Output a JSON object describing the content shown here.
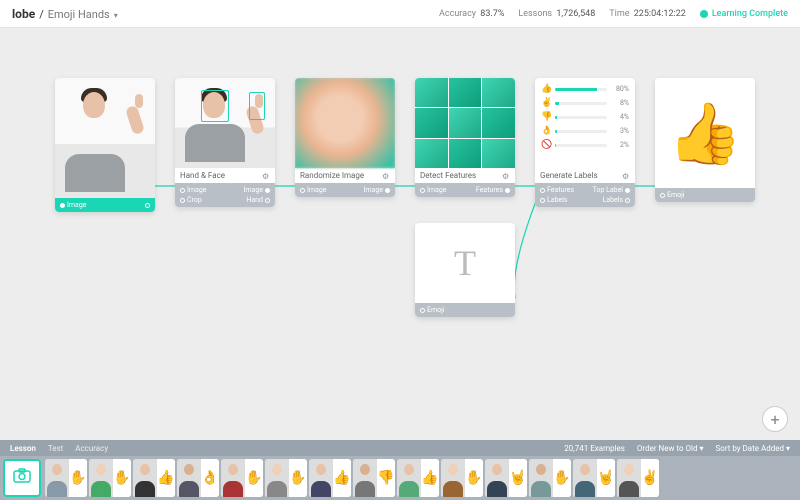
{
  "header": {
    "brand": "lobe",
    "divider": "/",
    "project": "Emoji Hands",
    "stats": {
      "accuracy_label": "Accuracy",
      "accuracy_value": "83.7%",
      "lessons_label": "Lessons",
      "lessons_value": "1,726,548",
      "time_label": "Time",
      "time_value": "225:04:12:22"
    },
    "status_text": "Learning Complete"
  },
  "icons": {
    "chevron_down": "▾",
    "gear": "⚙",
    "camera": "📷",
    "plus": "+"
  },
  "nodes": {
    "input": {
      "port_in": "Image",
      "title": ""
    },
    "handface": {
      "title": "Hand & Face",
      "port_in": "Image",
      "port_out": "Image",
      "port_row2_left": "Crop",
      "port_row2_right": "Hand"
    },
    "randomize": {
      "title": "Randomize Image",
      "port_in": "Image",
      "port_out": "Image"
    },
    "detect": {
      "title": "Detect Features",
      "port_in": "Image",
      "port_out": "Features"
    },
    "labels": {
      "title": "Generate Labels",
      "port_in": "Features",
      "port_out": "Top Label",
      "port_row2_left": "Labels",
      "port_row2_right": "Labels",
      "items": [
        {
          "glyph": "👍",
          "pct": 80
        },
        {
          "glyph": "✌️",
          "pct": 8
        },
        {
          "glyph": "👎",
          "pct": 4
        },
        {
          "glyph": "👌",
          "pct": 3
        },
        {
          "glyph": "🚫",
          "pct": 2
        }
      ],
      "pct_suffix": "%"
    },
    "output": {
      "title": "",
      "port_in": "Emoji",
      "glyph": "👍"
    },
    "text": {
      "glyph_T": "T",
      "port_in": "Emoji"
    }
  },
  "footer": {
    "tabs": [
      "Lesson",
      "Test",
      "Accuracy"
    ],
    "active_tab": "Lesson",
    "examples_count": "20,741 Examples",
    "order_label": "Order New to Old",
    "sort_label": "Sort by Date Added",
    "thumbs": [
      {
        "emoji": "✋",
        "skin": "#e8c2a8",
        "shirt": "#8899aa"
      },
      {
        "emoji": "✋",
        "skin": "#f0d0b8",
        "shirt": "#4a6"
      },
      {
        "emoji": "👍",
        "skin": "#e8c2a8",
        "shirt": "#333"
      },
      {
        "emoji": "👌",
        "skin": "#d9b090",
        "shirt": "#556"
      },
      {
        "emoji": "✋",
        "skin": "#e8c2a8",
        "shirt": "#a33"
      },
      {
        "emoji": "✋",
        "skin": "#f0d0b8",
        "shirt": "#888"
      },
      {
        "emoji": "👍",
        "skin": "#e8c2a8",
        "shirt": "#446"
      },
      {
        "emoji": "👎",
        "skin": "#d9b090",
        "shirt": "#777"
      },
      {
        "emoji": "👍",
        "skin": "#e8c2a8",
        "shirt": "#5a7"
      },
      {
        "emoji": "✋",
        "skin": "#f0d0b8",
        "shirt": "#963"
      },
      {
        "emoji": "🤘",
        "skin": "#e8c2a8",
        "shirt": "#345"
      },
      {
        "emoji": "✋",
        "skin": "#d9b090",
        "shirt": "#799"
      },
      {
        "emoji": "🤘",
        "skin": "#e8c2a8",
        "shirt": "#467"
      },
      {
        "emoji": "✌️",
        "skin": "#f0d0b8",
        "shirt": "#555"
      }
    ]
  }
}
